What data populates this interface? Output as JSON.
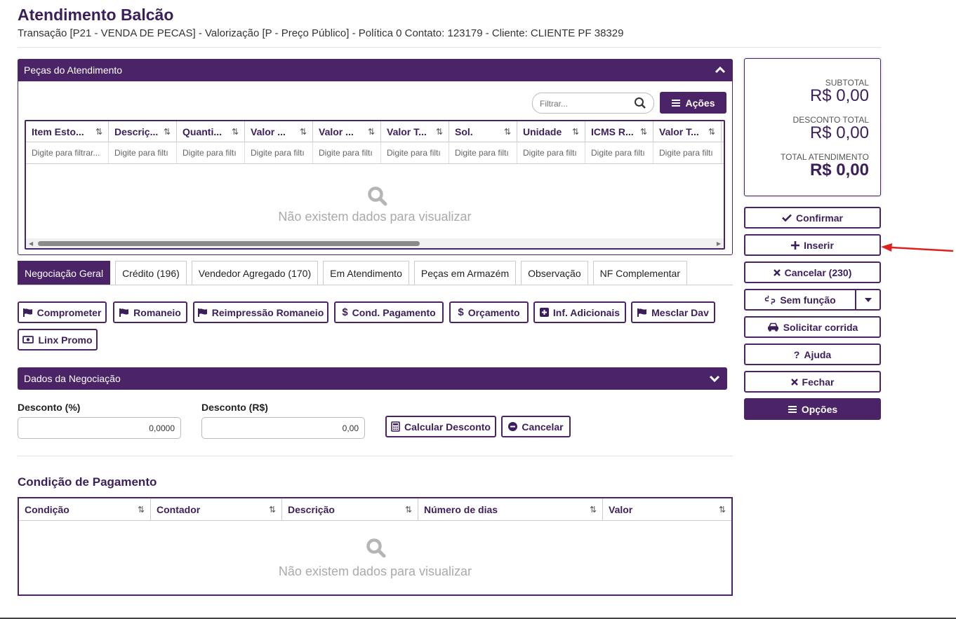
{
  "header": {
    "title": "Atendimento Balcão",
    "subtitle": "Transação [P21 - VENDA DE PECAS] - Valorização [P - Preço Público] - Política 0 Contato: 123179 - Cliente: CLIENTE PF 38329"
  },
  "pecas_panel": {
    "title": "Peças do Atendimento",
    "filter_placeholder": "Filtrar...",
    "actions_label": "Ações",
    "columns": [
      "Item Esto...",
      "Descriç...",
      "Quanti...",
      "Valor ...",
      "Valor ...",
      "Valor T...",
      "Sol.",
      "Unidade",
      "ICMS R...",
      "Valor T..."
    ],
    "filter_placeholders": [
      "Digite para filtrar...",
      "Digite para filtı",
      "Digite para filtı",
      "Digite para filtı",
      "Digite para filtı",
      "Digite para filtı",
      "Digite para filtı",
      "Digite para filtı",
      "Digite para filtı",
      "Digite para filtı"
    ],
    "empty_message": "Não existem dados para visualizar"
  },
  "tabs": [
    "Negociação Geral",
    "Crédito (196)",
    "Vendedor Agregado (170)",
    "Em Atendimento",
    "Peças em Armazém",
    "Observação",
    "NF Complementar"
  ],
  "action_buttons": [
    "Comprometer",
    "Romaneio",
    "Reimpressão Romaneio",
    "Cond. Pagamento",
    "Orçamento",
    "Inf. Adicionais",
    "Mesclar Dav",
    "Linx Promo"
  ],
  "negociacao": {
    "title": "Dados da Negociação",
    "desconto_pct_label": "Desconto (%)",
    "desconto_pct_value": "0,0000",
    "desconto_rs_label": "Desconto (R$)",
    "desconto_rs_value": "0,00",
    "calcular_label": "Calcular Desconto",
    "cancelar_label": "Cancelar"
  },
  "pagamento": {
    "title": "Condição de Pagamento",
    "columns": [
      "Condição",
      "Contador",
      "Descrição",
      "Número de dias",
      "Valor"
    ],
    "empty_message": "Não existem dados para visualizar"
  },
  "totals": {
    "subtotal_label": "SUBTOTAL",
    "subtotal_value": "R$ 0,00",
    "desconto_label": "DESCONTO TOTAL",
    "desconto_value": "R$ 0,00",
    "total_label": "TOTAL ATENDIMENTO",
    "total_value": "R$ 0,00"
  },
  "side_buttons": {
    "confirmar": "Confirmar",
    "inserir": "Inserir",
    "cancelar": "Cancelar (230)",
    "sem_funcao": "Sem função",
    "solicitar_corrida": "Solicitar corrida",
    "ajuda": "Ajuda",
    "fechar": "Fechar",
    "opcoes": "Opções"
  },
  "colors": {
    "primary": "#4a2466",
    "annotation_arrow": "#e02020"
  }
}
